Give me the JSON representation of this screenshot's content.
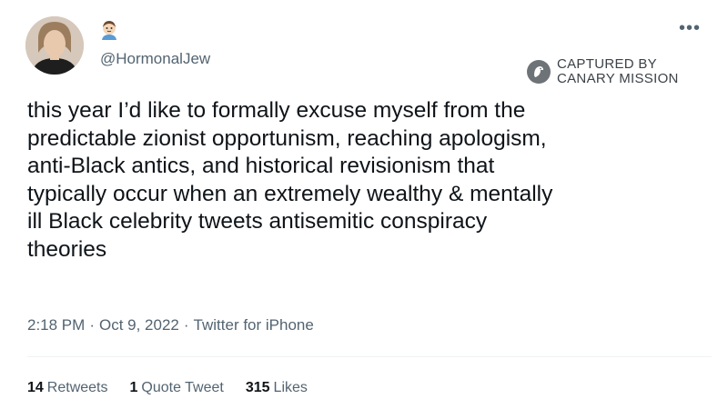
{
  "tweet": {
    "handle": "@HormonalJew",
    "display_emoji": "face-icon",
    "more_label": "•••",
    "text_lines": [
      "this year I’d like to formally excuse myself from the",
      "predictable zionist opportunism, reaching apologism,",
      "anti-Black antics, and historical revisionism that",
      "typically occur when an extremely wealthy & mentally",
      "ill Black celebrity tweets antisemitic conspiracy",
      "theories"
    ],
    "time": "2:18 PM",
    "date": "Oct 9, 2022",
    "separator": "·",
    "client": "Twitter for iPhone",
    "stats": {
      "retweets_count": "14",
      "retweets_label": "Retweets",
      "quotes_count": "1",
      "quotes_label": "Quote Tweet",
      "likes_count": "315",
      "likes_label": "Likes"
    }
  },
  "watermark": {
    "line1": "CAPTURED BY",
    "line2": "CANARY MISSION",
    "logo": "canary-mission-logo"
  },
  "colors": {
    "text": "#0f1419",
    "secondary": "#536471",
    "divider": "#eff3f4"
  }
}
